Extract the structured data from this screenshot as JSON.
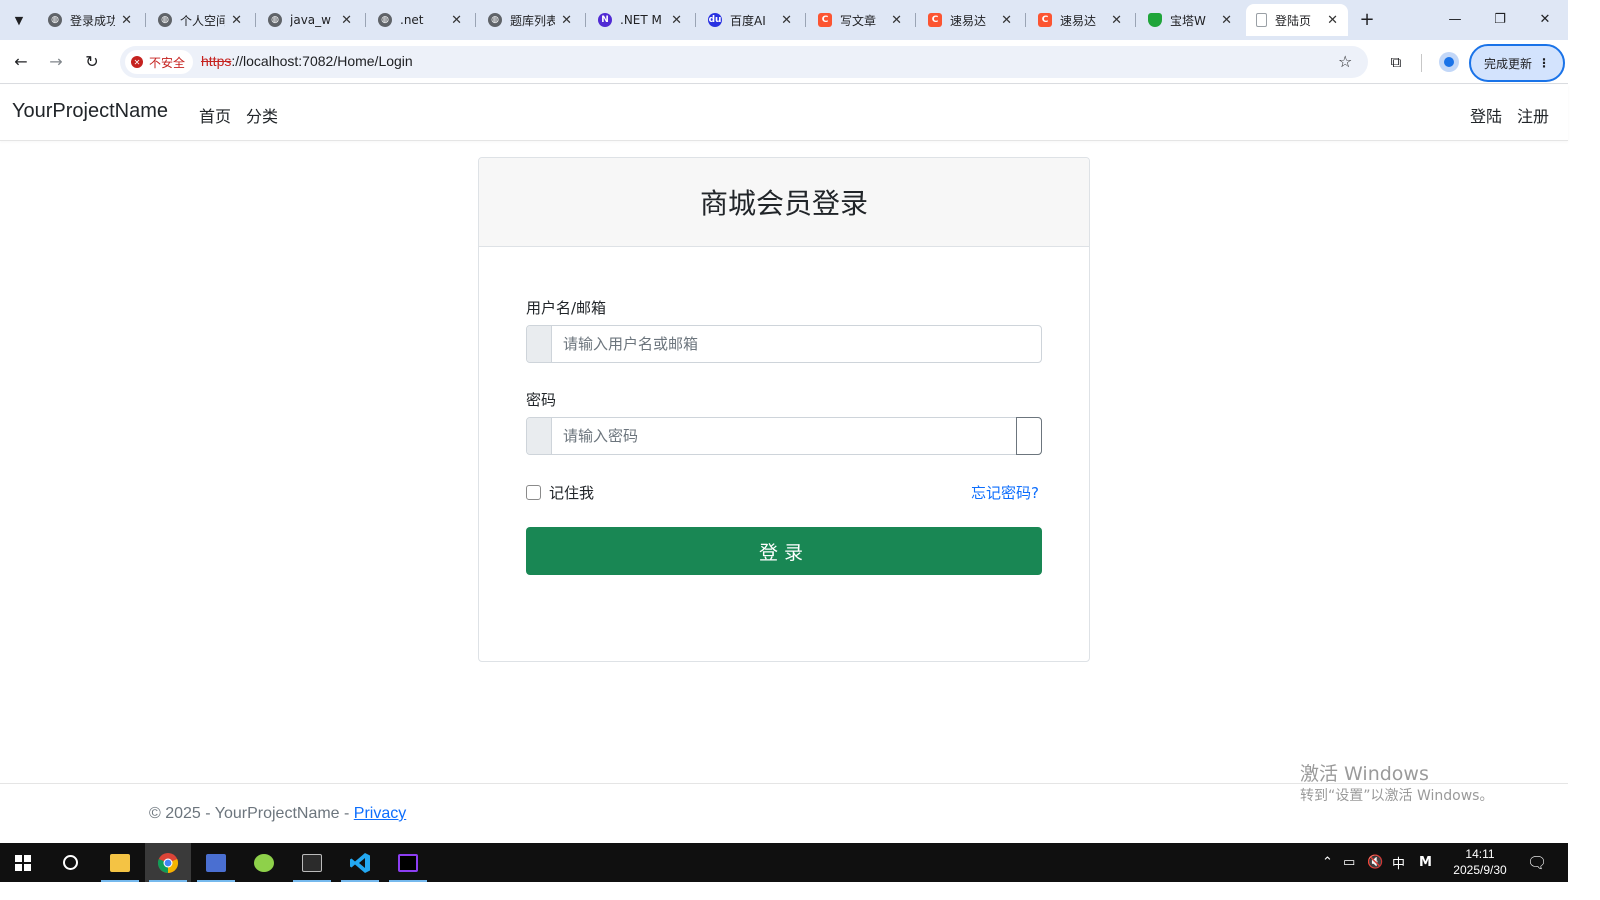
{
  "browser": {
    "tabs": [
      {
        "title": "登录成功",
        "favicon": "globe-icon",
        "active": false
      },
      {
        "title": "个人空间",
        "favicon": "globe-icon",
        "active": false
      },
      {
        "title": "java_w",
        "favicon": "globe-icon",
        "active": false
      },
      {
        "title": ".net",
        "favicon": "globe-icon",
        "active": false
      },
      {
        "title": "题库列表",
        "favicon": "globe-icon",
        "active": false
      },
      {
        "title": ".NET M",
        "favicon": "dotnet-icon",
        "active": false
      },
      {
        "title": "百度AI",
        "favicon": "baidu-icon",
        "active": false
      },
      {
        "title": "写文章",
        "favicon": "csdn-icon",
        "active": false
      },
      {
        "title": "速易达",
        "favicon": "csdn-icon",
        "active": false
      },
      {
        "title": "速易达",
        "favicon": "csdn-icon",
        "active": false
      },
      {
        "title": "宝塔W",
        "favicon": "shield-icon",
        "active": false
      },
      {
        "title": "登陆页",
        "favicon": "page-icon",
        "active": true
      }
    ],
    "security_label": "不安全",
    "url_scheme": "https",
    "url_rest": "://localhost:7082/Home/Login",
    "update_button": "完成更新"
  },
  "site": {
    "brand": "YourProjectName",
    "nav_left": [
      "首页",
      "分类"
    ],
    "nav_right": [
      "登陆",
      "注册"
    ]
  },
  "login": {
    "title": "商城会员登录",
    "username_label": "用户名/邮箱",
    "username_placeholder": "请输入用户名或邮箱",
    "password_label": "密码",
    "password_placeholder": "请输入密码",
    "remember_label": "记住我",
    "forgot_link": "忘记密码?",
    "submit": "登录"
  },
  "footer": {
    "copyright": "© 2025 - YourProjectName - ",
    "privacy": "Privacy"
  },
  "watermark": {
    "line1": "激活 Windows",
    "line2": "转到“设置”以激活 Windows。"
  },
  "taskbar": {
    "ime": "中",
    "time": "14:11",
    "date": "2025/9/30"
  },
  "colors": {
    "primary_button": "#198754",
    "link": "#0d6efd",
    "chrome_accent": "#1a73e8"
  }
}
